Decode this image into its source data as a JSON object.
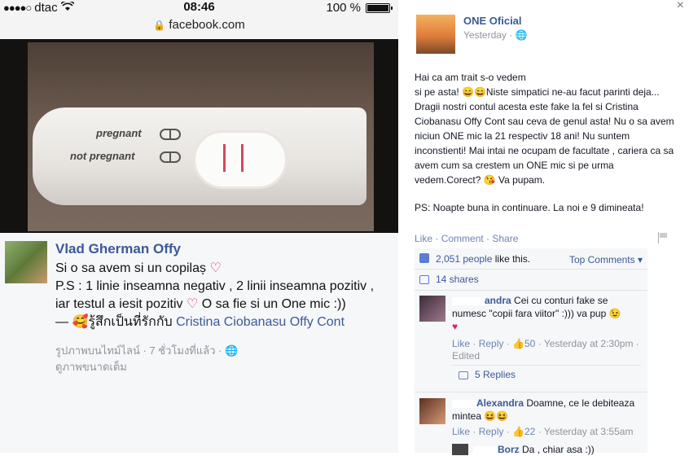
{
  "statusbar": {
    "carrier": "dtac",
    "signal": "●●●●○",
    "time": "08:46",
    "battery": "100 %"
  },
  "urlbar": {
    "url": "facebook.com"
  },
  "photo": {
    "label_pregnant": "pregnant",
    "label_not_pregnant": "not pregnant"
  },
  "post": {
    "name": "Vlad Gherman Offy",
    "line1": "Si o sa avem si un copilaș",
    "line2": "P.S : 1 linie inseamna negativ , 2 linii inseamna pozitiv , iar testul a iesit pozitiv",
    "line2b": "O sa fie si un One mic :))",
    "feeling_prefix": "—",
    "feeling": "รู้สึกเป็นที่รักกับ",
    "tagged": "Cristina Ciobanasu Offy Cont",
    "meta1": "รูปภาพบนไทม์ไลน์ · 7 ชั่วโมงที่แล้ว ·",
    "meta2": "ดูภาพขนาดเต็ม"
  },
  "right": {
    "page_name": "ONE Oficial",
    "time": "Yesterday ·",
    "status_lines": [
      "Hai ca am trait s-o vedem",
      "si pe asta! 😄😄Niste simpatici ne-au facut parinti deja... Dragii nostri contul acesta este fake la fel si Cristina Ciobanasu Offy Cont sau ceva de genul asta! Nu o sa avem niciun ONE mic la 21 respectiv 18 ani! Nu suntem inconstienti! Mai intai ne ocupam de facultate , cariera ca sa avem cum sa crestem un ONE mic si pe urma vedem.Corect? 😘 Va pupam.",
      "PS: Noapte buna in continuare. La noi e 9 dimineata!"
    ],
    "actions": {
      "like": "Like",
      "comment": "Comment",
      "share": "Share"
    },
    "likes_count": "2,051 people",
    "likes_suffix": " like this.",
    "top_comments": "Top Comments ▾",
    "shares": "14 shares",
    "comments": [
      {
        "name": "andra",
        "text": "Cei cu conturi fake se numesc \"copii fara viitor\" :))) va pup 😉",
        "heart": "♥",
        "like": "Like",
        "reply": "Reply",
        "likes": "50",
        "time": "Yesterday at 2:30pm",
        "edited": "Edited",
        "replies": "5 Replies"
      },
      {
        "name": "Alexandra",
        "text": "Doamne, ce le debiteaza mintea 😆😆",
        "like": "Like",
        "reply": "Reply",
        "likes": "22",
        "time": "Yesterday at 3:55am"
      },
      {
        "name": "Borz",
        "text": "Da , chiar asa :))"
      }
    ]
  }
}
